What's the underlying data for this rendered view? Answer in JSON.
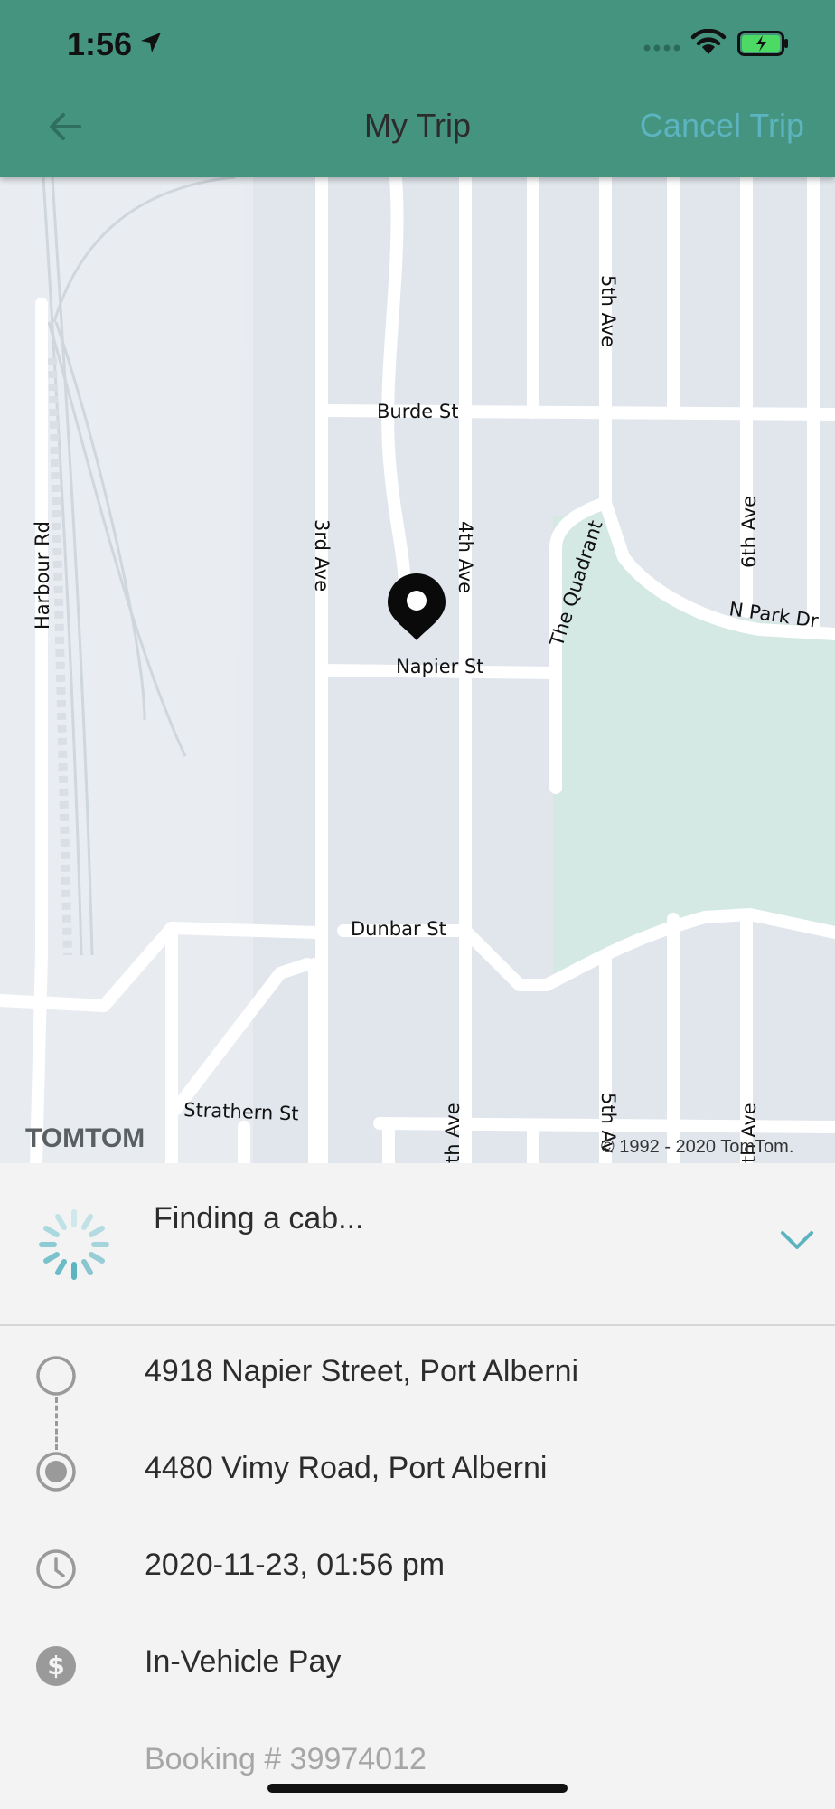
{
  "status_bar": {
    "time": "1:56"
  },
  "header": {
    "title": "My Trip",
    "cancel_label": "Cancel Trip"
  },
  "map": {
    "streets": {
      "burde": "Burde St",
      "fifth_top": "5th Ave",
      "harbour": "Harbour Rd",
      "third": "3rd Ave",
      "fourth": "4th Ave",
      "quadrant": "The Quadrant",
      "sixth": "6th Ave",
      "npark": "N Park Dr",
      "napier": "Napier St",
      "dunbar": "Dunbar St",
      "strathern": "Strathern St",
      "fourth_bottom": "th Ave",
      "fifth_bottom": "5th Av",
      "sixth_bottom": "th Ave"
    },
    "logo": "TOMTOM",
    "copyright": "© 1992 - 2020 TomTom."
  },
  "trip": {
    "status": "Finding a cab...",
    "pickup": "4918 Napier Street, Port Alberni",
    "dropoff": "4480 Vimy Road, Port Alberni",
    "datetime": "2020-11-23, 01:56 pm",
    "payment": "In-Vehicle Pay",
    "booking": "Booking # 39974012"
  },
  "colors": {
    "header": "#45947f",
    "accent": "#5cb4c0",
    "map_bg": "#e0e6ec",
    "park": "#d4e9e4"
  },
  "icons": [
    "location-arrow-icon",
    "signal-icon",
    "wifi-icon",
    "battery-icon",
    "back-arrow-icon",
    "map-pin-icon",
    "spinner-icon",
    "chevron-down-icon",
    "pickup-circle-icon",
    "dropoff-circle-icon",
    "clock-icon",
    "dollar-icon"
  ]
}
